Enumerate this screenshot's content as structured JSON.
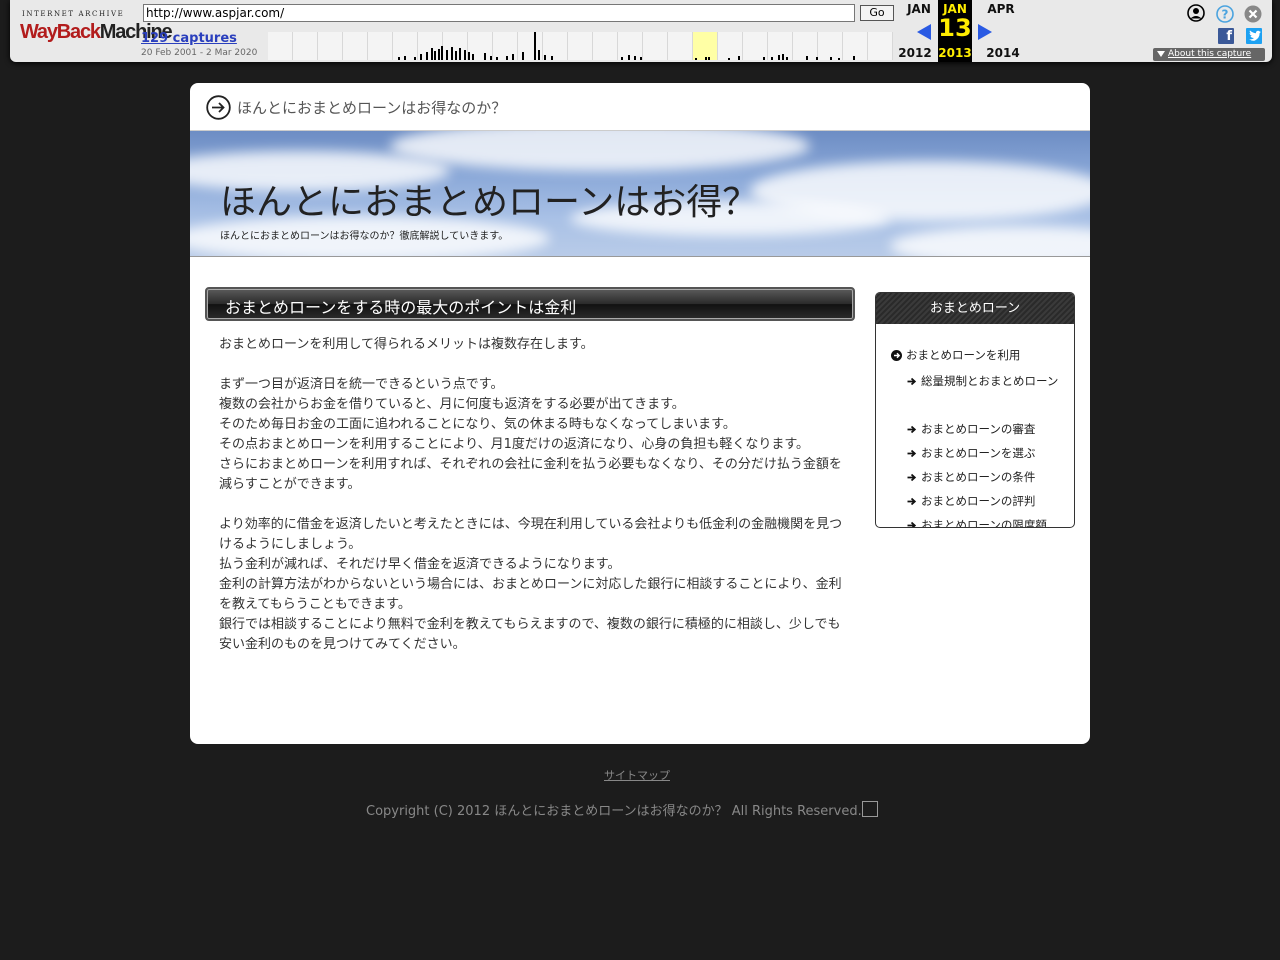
{
  "wayback": {
    "logo_top": "INTERNET ARCHIVE",
    "logo_main_red": "WayBack",
    "logo_main_dark": "Machine",
    "url": "http://www.aspjar.com/",
    "go_label": "Go",
    "captures": "129 captures",
    "date_range": "20 Feb 2001 - 2 Mar 2020",
    "prev_month": "JAN",
    "prev_year": "2012",
    "cur_month": "JAN",
    "cur_day": "13",
    "cur_year": "2013",
    "next_month": "APR",
    "next_year": "2014",
    "about": "About this capture"
  },
  "site": {
    "topbar_title": "ほんとにおまとめローンはお得なのか？",
    "header_title": "ほんとにおまとめローンはお得？",
    "header_subtitle": "ほんとにおまとめローンはお得なのか？徹底解説していきます。",
    "main_heading": "おまとめローンをする時の最大のポイントは金利",
    "article": [
      "おまとめローンを利用して得られるメリットは複数存在します。",
      "",
      "まず一つ目が返済日を統一できるという点です。",
      "複数の会社からお金を借りていると、月に何度も返済をする必要が出てきます。",
      "そのため毎日お金の工面に追われることになり、気の休まる時もなくなってしまいます。",
      "その点おまとめローンを利用することにより、月1度だけの返済になり、心身の負担も軽くなります。",
      "さらにおまとめローンを利用すれば、それぞれの会社に金利を払う必要もなくなり、その分だけ払う金額を減らすことができます。",
      "",
      "より効率的に借金を返済したいと考えたときには、今現在利用している会社よりも低金利の金融機関を見つけるようにしましょう。",
      "払う金利が減れば、それだけ早く借金を返済できるようになります。",
      "金利の計算方法がわからないという場合には、おまとめローンに対応した銀行に相談することにより、金利を教えてもらうこともできます。",
      "銀行では相談することにより無料で金利を教えてもらえますので、複数の銀行に積極的に相談し、少しでも安い金利のものを見つけてみてください。"
    ],
    "sidebar": {
      "heading": "おまとめローン",
      "parent": "おまとめローンを利用",
      "children": [
        "総量規制とおまとめローン",
        "おまとめローンの審査",
        "おまとめローンを選ぶ",
        "おまとめローンの条件",
        "おまとめローンの評判",
        "おまとめローンの限度額"
      ]
    },
    "footer_link": "サイトマップ",
    "copyright": "Copyright (C) 2012 ほんとにおまとめローンはお得なのか？ All Rights Reserved."
  },
  "colors": {
    "page_bg": "#1c1c1c",
    "wayback_bar": "#e9e9e9",
    "wayback_accent": "#ffed00",
    "link_blue": "#2a3fbd"
  }
}
